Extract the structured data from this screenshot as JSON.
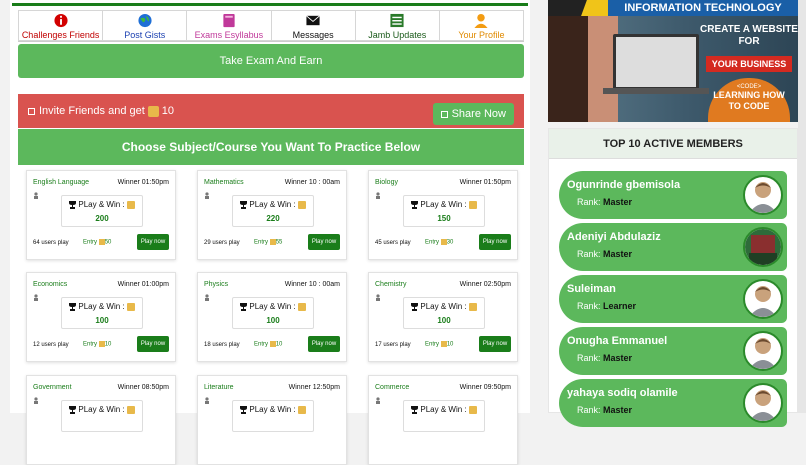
{
  "nav": [
    {
      "label": "Challenges Friends",
      "color": "#c00000",
      "icon": "info-icon"
    },
    {
      "label": "Post Gists",
      "color": "#1a3fb0",
      "icon": "globe-icon"
    },
    {
      "label": "Exams Esyllabus",
      "color": "#c0399a",
      "icon": "book-icon"
    },
    {
      "label": "Messages",
      "color": "#111111",
      "icon": "mail-icon"
    },
    {
      "label": "Jamb Updates",
      "color": "#1a5a1a",
      "icon": "list-icon"
    },
    {
      "label": "Your Profile",
      "color": "#e08a00",
      "icon": "user-icon"
    }
  ],
  "take_exam": "Take Exam And Earn",
  "invite": {
    "text": "Invite Friends and get",
    "amount": "10",
    "share": "Share Now"
  },
  "choose": "Choose Subject/Course You Want To Practice Below",
  "cards": [
    {
      "subject": "English Language",
      "winner": "Winner 01:50pm",
      "play": "PLay & Win :",
      "amount": "200",
      "users": "64 users play",
      "entry": "Entry",
      "entry_amt": "50",
      "btn": "Play now"
    },
    {
      "subject": "Mathematics",
      "winner": "Winner 10 : 00am",
      "play": "PLay & Win :",
      "amount": "220",
      "users": "29 users play",
      "entry": "Entry",
      "entry_amt": "55",
      "btn": "Play now"
    },
    {
      "subject": "Biology",
      "winner": "Winner 01:50pm",
      "play": "PLay & Win :",
      "amount": "150",
      "users": "45 users play",
      "entry": "Entry",
      "entry_amt": "30",
      "btn": "Play now"
    },
    {
      "subject": "Economics",
      "winner": "Winner 01:00pm",
      "play": "PLay & Win :",
      "amount": "100",
      "users": "12 users play",
      "entry": "Entry",
      "entry_amt": "10",
      "btn": "Play now"
    },
    {
      "subject": "Physics",
      "winner": "Winner 10 : 00am",
      "play": "PLay & Win :",
      "amount": "100",
      "users": "18 users play",
      "entry": "Entry",
      "entry_amt": "10",
      "btn": "Play now"
    },
    {
      "subject": "Chemistry",
      "winner": "Winner 02:50pm",
      "play": "PLay & Win :",
      "amount": "100",
      "users": "17 users play",
      "entry": "Entry",
      "entry_amt": "10",
      "btn": "Play now"
    },
    {
      "subject": "Government",
      "winner": "Winner 08:50pm",
      "play": "PLay & Win :",
      "amount": "",
      "users": "",
      "entry": "",
      "entry_amt": "",
      "btn": ""
    },
    {
      "subject": "Literature",
      "winner": "Winner 12:50pm",
      "play": "PLay & Win :",
      "amount": "",
      "users": "",
      "entry": "",
      "entry_amt": "",
      "btn": ""
    },
    {
      "subject": "Commerce",
      "winner": "Winner 09:50pm",
      "play": "PLay & Win :",
      "amount": "",
      "users": "",
      "entry": "",
      "entry_amt": "",
      "btn": ""
    }
  ],
  "ad": {
    "top": "INFORMATION TECHNOLOGY",
    "create": "CREATE A WEBSITE FOR",
    "business": "YOUR BUSINESS",
    "code_small": "<CODE>",
    "code_big": "LEARNING HOW TO CODE"
  },
  "members_title": "TOP 10 ACTIVE MEMBERS",
  "members": [
    {
      "name": "Ogunrinde gbemisola",
      "rank_label": "Rank:",
      "rank": "Master"
    },
    {
      "name": "Adeniyi Abdulaziz",
      "rank_label": "Rank:",
      "rank": "Master"
    },
    {
      "name": "Suleiman",
      "rank_label": "Rank:",
      "rank": "Learner"
    },
    {
      "name": "Onugha Emmanuel",
      "rank_label": "Rank:",
      "rank": "Master"
    },
    {
      "name": "yahaya sodiq olamile",
      "rank_label": "Rank:",
      "rank": "Master"
    }
  ]
}
